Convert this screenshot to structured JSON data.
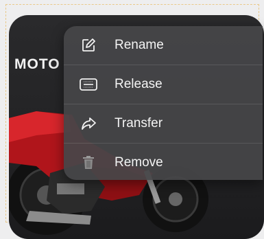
{
  "brand": {
    "text": "MOTO"
  },
  "menu": {
    "items": [
      {
        "label": "Rename",
        "icon": "edit-icon"
      },
      {
        "label": "Release",
        "icon": "release-icon"
      },
      {
        "label": "Transfer",
        "icon": "share-arrow-icon"
      },
      {
        "label": "Remove",
        "icon": "trash-icon"
      }
    ]
  },
  "colors": {
    "menu_bg": "#464648",
    "card_bg": "#232325",
    "accent_red": "#c8161d",
    "frame_dashed": "#e9c98a"
  }
}
